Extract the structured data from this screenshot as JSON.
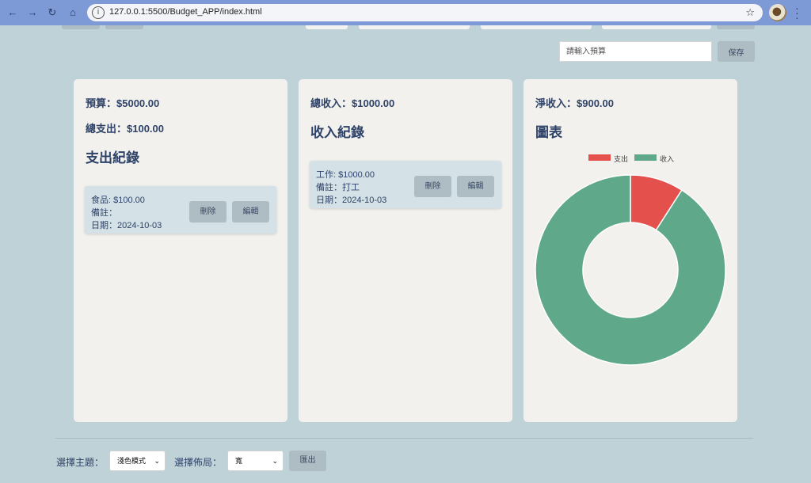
{
  "browser": {
    "url": "127.0.0.1:5500/Budget_APP/index.html"
  },
  "budget_form": {
    "placeholder": "請輸入預算",
    "save_label": "保存"
  },
  "expense_card": {
    "budget": "預算：$5000.00",
    "total_expense": "總支出：$100.00",
    "heading": "支出紀錄",
    "records": [
      {
        "category": "食品: $100.00",
        "note": "備註：",
        "date": "日期：2024-10-03",
        "delete_label": "刪除",
        "edit_label": "編輯"
      }
    ]
  },
  "income_card": {
    "total_income": "總收入：$1000.00",
    "heading": "收入紀錄",
    "records": [
      {
        "category": "工作: $1000.00",
        "note": "備註：打工",
        "date": "日期：2024-10-03",
        "delete_label": "刪除",
        "edit_label": "編輯"
      }
    ]
  },
  "chart_card": {
    "net_income": "淨收入：$900.00",
    "heading": "圖表"
  },
  "chart_data": {
    "type": "pie",
    "variant": "doughnut",
    "categories": [
      "支出",
      "收入"
    ],
    "values": [
      100,
      1000
    ],
    "colors": [
      "#e4514d",
      "#5fa88a"
    ],
    "legend_position": "top"
  },
  "footer": {
    "theme_label": "選擇主題：",
    "theme_value": "淺色模式",
    "layout_label": "選擇佈局：",
    "layout_value": "寬",
    "export_label": "匯出"
  }
}
